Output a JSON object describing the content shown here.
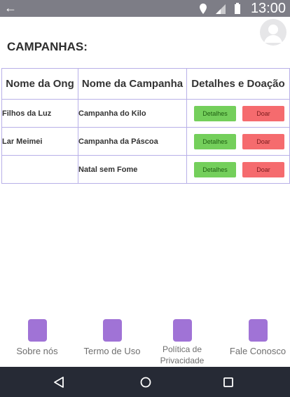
{
  "status": {
    "time": "13:00"
  },
  "page": {
    "title": "CAMPANHAS:"
  },
  "table": {
    "headers": [
      "Nome da Ong",
      "Nome da Campanha",
      "Detalhes e Doação"
    ],
    "rows": [
      {
        "ong": "Filhos da Luz",
        "campanha": "Campanha do Kilo",
        "details": "Detalhes",
        "donate": "Doar"
      },
      {
        "ong": "Lar Meimei",
        "campanha": "Campanha da Páscoa",
        "details": "Detalhes",
        "donate": "Doar"
      },
      {
        "ong": "",
        "campanha": "Natal sem Fome",
        "details": "Detalhes",
        "donate": "Doar"
      }
    ]
  },
  "footer": {
    "items": [
      {
        "label": "Sobre nós",
        "icon": "info-square-icon"
      },
      {
        "label": "Termo de Uso",
        "icon": "document-square-icon"
      },
      {
        "label": "Política de Privacidade",
        "icon": "privacy-square-icon"
      },
      {
        "label": "Fale Conosco",
        "icon": "contact-square-icon"
      }
    ]
  },
  "system_nav": {
    "icons": [
      "back-triangle-icon",
      "home-circle-icon",
      "recents-square-icon"
    ]
  },
  "colors": {
    "status_bar": "#7d7d86",
    "details_button": "#74cf5b",
    "donate_button": "#f56b6e",
    "table_border": "#b8b0e8",
    "footer_icon": "#a073d6",
    "system_bar": "#262a35"
  }
}
